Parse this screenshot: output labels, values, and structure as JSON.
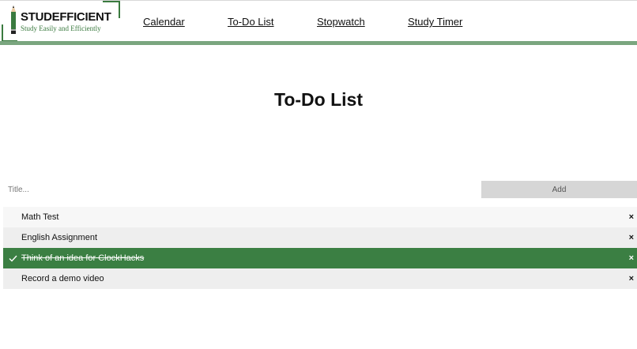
{
  "brand": {
    "name": "STUDEFFICIENT",
    "tagline": "Study Easily and Efficiently"
  },
  "nav": {
    "items": [
      {
        "label": "Calendar"
      },
      {
        "label": "To-Do List"
      },
      {
        "label": "Stopwatch"
      },
      {
        "label": "Study Timer"
      }
    ]
  },
  "page": {
    "title": "To-Do List"
  },
  "form": {
    "placeholder": "Title...",
    "value": "",
    "add_label": "Add"
  },
  "todos": [
    {
      "text": "Math Test",
      "checked": false
    },
    {
      "text": "English Assignment",
      "checked": false
    },
    {
      "text": "Think of an idea for ClockHacks",
      "checked": true
    },
    {
      "text": "Record a demo video",
      "checked": false
    }
  ],
  "close_glyph": "×",
  "colors": {
    "accent": "#3b7f43",
    "header_bar": "#7aa67f",
    "add_button": "#d6d6d6",
    "row_light": "#f7f7f7",
    "row_dark": "#eeeeee"
  },
  "icons": {
    "logo": "pencil-icon",
    "done": "check-icon",
    "remove": "close-icon"
  }
}
